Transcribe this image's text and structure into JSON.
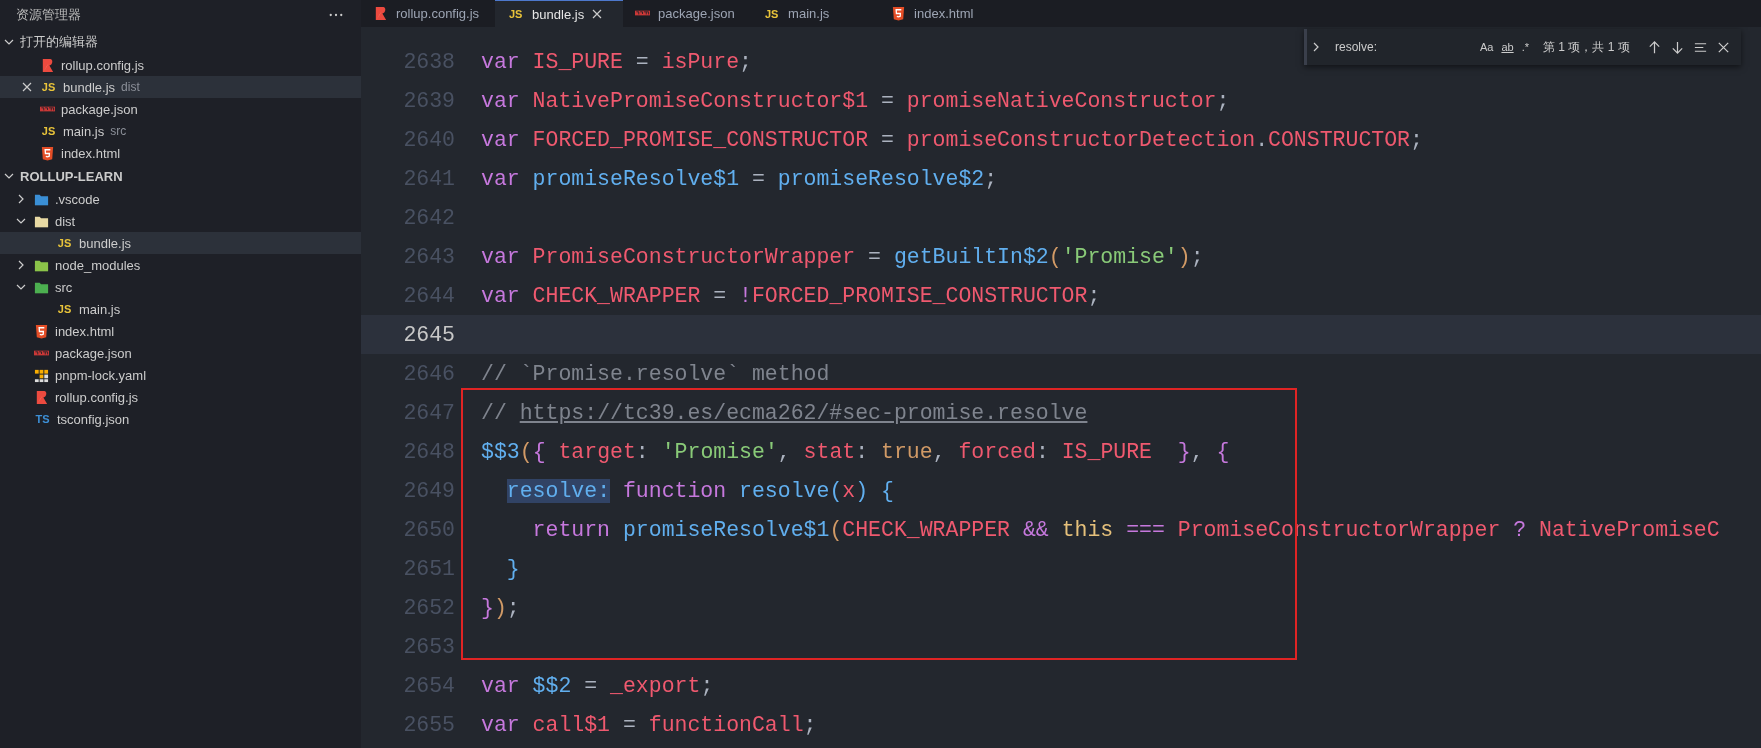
{
  "sidebar": {
    "title": "资源管理器",
    "open_editors": {
      "title": "打开的编辑器",
      "expanded": true,
      "items": [
        {
          "name": "rollup.config.js",
          "kind": "rollup",
          "selected": false
        },
        {
          "name": "bundle.js",
          "description": "dist",
          "kind": "js",
          "icon_label": "JS",
          "selected": true
        },
        {
          "name": "package.json",
          "kind": "npm",
          "selected": false
        },
        {
          "name": "main.js",
          "description": "src",
          "kind": "js",
          "icon_label": "JS",
          "selected": false
        },
        {
          "name": "index.html",
          "kind": "html",
          "selected": false
        }
      ]
    },
    "project": {
      "title": "ROLLUP-LEARN",
      "expanded": true,
      "items": [
        {
          "name": ".vscode",
          "kind": "folder-vscode",
          "expanded": false,
          "selected": false
        },
        {
          "name": "dist",
          "kind": "folder-dist",
          "expanded": true,
          "selected": false,
          "children": [
            {
              "name": "bundle.js",
              "kind": "js",
              "icon_label": "JS",
              "selected": true
            }
          ]
        },
        {
          "name": "node_modules",
          "kind": "folder-node",
          "expanded": false,
          "selected": false
        },
        {
          "name": "src",
          "kind": "folder-src",
          "expanded": true,
          "selected": false,
          "children": [
            {
              "name": "main.js",
              "kind": "js",
              "icon_label": "JS",
              "selected": false
            }
          ]
        },
        {
          "name": "index.html",
          "kind": "html",
          "selected": false
        },
        {
          "name": "package.json",
          "kind": "npm",
          "selected": false
        },
        {
          "name": "pnpm-lock.yaml",
          "kind": "yaml",
          "selected": false
        },
        {
          "name": "rollup.config.js",
          "kind": "rollup",
          "selected": false
        },
        {
          "name": "tsconfig.json",
          "kind": "ts",
          "icon_label": "TS",
          "selected": false
        }
      ]
    }
  },
  "tabs": [
    {
      "label": "rollup.config.js",
      "kind": "rollup",
      "selected": false
    },
    {
      "label": "bundle.js",
      "kind": "js",
      "icon_label": "JS",
      "selected": true
    },
    {
      "label": "package.json",
      "kind": "npm",
      "selected": false
    },
    {
      "label": "main.js",
      "kind": "js",
      "icon_label": "JS",
      "selected": false
    },
    {
      "label": "index.html",
      "kind": "html",
      "selected": false
    }
  ],
  "find": {
    "value": "resolve:",
    "options": [
      {
        "label": "Aa",
        "on": false
      },
      {
        "label": "ab",
        "on": false
      },
      {
        "label": ".*",
        "on": false
      }
    ],
    "result": "第 1 项，共 1 项"
  },
  "editor": {
    "lines": [
      {
        "number": "2638",
        "current": false,
        "tokens": [
          {
            "kind": "kw",
            "text": "var "
          },
          {
            "kind": "var",
            "text": "IS_PURE"
          },
          {
            "kind": "p",
            "text": " = "
          },
          {
            "kind": "var",
            "text": "isPure"
          },
          {
            "kind": "p",
            "text": ";"
          }
        ]
      },
      {
        "number": "2639",
        "current": false,
        "tokens": [
          {
            "kind": "kw",
            "text": "var "
          },
          {
            "kind": "var",
            "text": "NativePromiseConstructor$1"
          },
          {
            "kind": "p",
            "text": " = "
          },
          {
            "kind": "var",
            "text": "promiseNativeConstructor"
          },
          {
            "kind": "p",
            "text": ";"
          }
        ]
      },
      {
        "number": "2640",
        "current": false,
        "tokens": [
          {
            "kind": "kw",
            "text": "var "
          },
          {
            "kind": "var",
            "text": "FORCED_PROMISE_CONSTRUCTOR"
          },
          {
            "kind": "p",
            "text": " = "
          },
          {
            "kind": "var",
            "text": "promiseConstructorDetection"
          },
          {
            "kind": "p",
            "text": "."
          },
          {
            "kind": "var",
            "text": "CONSTRUCTOR"
          },
          {
            "kind": "p",
            "text": ";"
          }
        ]
      },
      {
        "number": "2641",
        "current": false,
        "tokens": [
          {
            "kind": "kw",
            "text": "var "
          },
          {
            "kind": "fn",
            "text": "promiseResolve$1"
          },
          {
            "kind": "p",
            "text": " = "
          },
          {
            "kind": "fn",
            "text": "promiseResolve$2"
          },
          {
            "kind": "p",
            "text": ";"
          }
        ]
      },
      {
        "number": "2642",
        "current": false
      },
      {
        "number": "2643",
        "current": false,
        "tokens": [
          {
            "kind": "kw",
            "text": "var "
          },
          {
            "kind": "var",
            "text": "PromiseConstructorWrapper"
          },
          {
            "kind": "p",
            "text": " = "
          },
          {
            "kind": "fn",
            "text": "getBuiltIn$2"
          },
          {
            "kind": "b1",
            "text": "("
          },
          {
            "kind": "str",
            "text": "'Promise'"
          },
          {
            "kind": "b1",
            "text": ")"
          },
          {
            "kind": "p",
            "text": ";"
          }
        ]
      },
      {
        "number": "2644",
        "current": false,
        "tokens": [
          {
            "kind": "kw",
            "text": "var "
          },
          {
            "kind": "var",
            "text": "CHECK_WRAPPER"
          },
          {
            "kind": "p",
            "text": " = "
          },
          {
            "kind": "kw",
            "text": "!"
          },
          {
            "kind": "var",
            "text": "FORCED_PROMISE_CONSTRUCTOR"
          },
          {
            "kind": "p",
            "text": ";"
          }
        ]
      },
      {
        "number": "2645",
        "current": true
      },
      {
        "number": "2646",
        "current": false,
        "tokens": [
          {
            "kind": "cm",
            "text": "// `Promise.resolve` method"
          }
        ]
      },
      {
        "number": "2647",
        "current": false,
        "tokens": [
          {
            "kind": "cm",
            "text": "// "
          },
          {
            "kind": "link",
            "text": "https://tc39.es/ecma262/#sec-promise.resolve"
          }
        ]
      },
      {
        "number": "2648",
        "current": false,
        "tokens": [
          {
            "kind": "fn",
            "text": "$$3"
          },
          {
            "kind": "b1",
            "text": "("
          },
          {
            "kind": "b2",
            "text": "{ "
          },
          {
            "kind": "var",
            "text": "target"
          },
          {
            "kind": "p",
            "text": ": "
          },
          {
            "kind": "str",
            "text": "'Promise'"
          },
          {
            "kind": "p",
            "text": ", "
          },
          {
            "kind": "var",
            "text": "stat"
          },
          {
            "kind": "p",
            "text": ": "
          },
          {
            "kind": "num",
            "text": "true"
          },
          {
            "kind": "p",
            "text": ", "
          },
          {
            "kind": "var",
            "text": "forced"
          },
          {
            "kind": "p",
            "text": ": "
          },
          {
            "kind": "var",
            "text": "IS_PURE"
          },
          {
            "kind": "b2",
            "text": "  }"
          },
          {
            "kind": "p",
            "text": ", "
          },
          {
            "kind": "b2",
            "text": "{"
          }
        ]
      },
      {
        "number": "2649",
        "current": false,
        "tokens": [
          {
            "kind": "match",
            "text": "  resolve:"
          },
          {
            "kind": "kw",
            "text": " function "
          },
          {
            "kind": "fn",
            "text": "resolve"
          },
          {
            "kind": "b3",
            "text": "("
          },
          {
            "kind": "var",
            "text": "x"
          },
          {
            "kind": "b3",
            "text": ") {"
          }
        ]
      },
      {
        "number": "2650",
        "current": false,
        "tokens": [
          {
            "kind": "kw",
            "text": "    return "
          },
          {
            "kind": "fn",
            "text": "promiseResolve$1"
          },
          {
            "kind": "b1",
            "text": "("
          },
          {
            "kind": "var",
            "text": "CHECK_WRAPPER "
          },
          {
            "kind": "kw",
            "text": "&& "
          },
          {
            "kind": "this",
            "text": "this "
          },
          {
            "kind": "kw",
            "text": "=== "
          },
          {
            "kind": "var",
            "text": "PromiseConstructorWrapper "
          },
          {
            "kind": "kw",
            "text": "? "
          },
          {
            "kind": "var",
            "text": "NativePromiseC"
          }
        ]
      },
      {
        "number": "2651",
        "current": false,
        "tokens": [
          {
            "kind": "b3",
            "text": "  }"
          }
        ]
      },
      {
        "number": "2652",
        "current": false,
        "tokens": [
          {
            "kind": "b2",
            "text": "}"
          },
          {
            "kind": "b1",
            "text": ")"
          },
          {
            "kind": "p",
            "text": ";"
          }
        ]
      },
      {
        "number": "2653",
        "current": false
      },
      {
        "number": "2654",
        "current": false,
        "tokens": [
          {
            "kind": "kw",
            "text": "var "
          },
          {
            "kind": "fn",
            "text": "$$2"
          },
          {
            "kind": "p",
            "text": " = "
          },
          {
            "kind": "var",
            "text": "_export"
          },
          {
            "kind": "p",
            "text": ";"
          }
        ]
      },
      {
        "number": "2655",
        "current": false,
        "tokens": [
          {
            "kind": "kw",
            "text": "var "
          },
          {
            "kind": "var",
            "text": "call$1"
          },
          {
            "kind": "p",
            "text": " = "
          },
          {
            "kind": "var",
            "text": "functionCall"
          },
          {
            "kind": "p",
            "text": ";"
          }
        ]
      }
    ]
  }
}
